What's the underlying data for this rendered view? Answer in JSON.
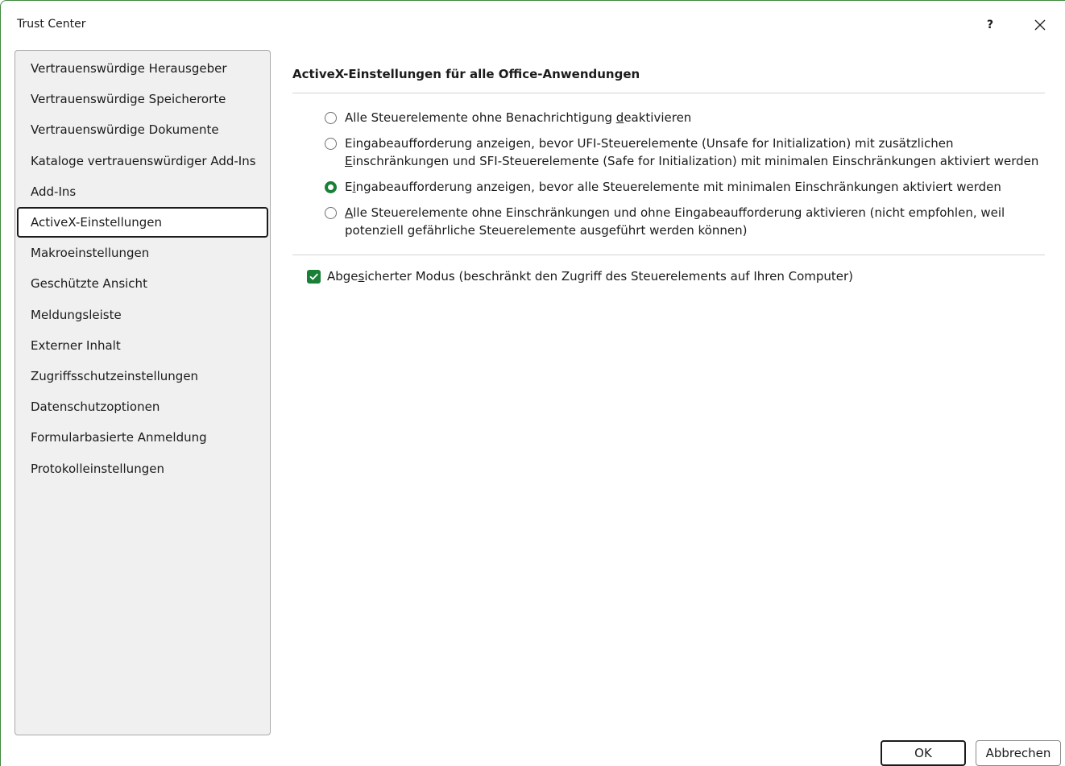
{
  "window": {
    "title": "Trust Center",
    "help_label": "?"
  },
  "sidebar": {
    "items": [
      {
        "label": "Vertrauenswürdige Herausgeber",
        "selected": false
      },
      {
        "label": "Vertrauenswürdige Speicherorte",
        "selected": false
      },
      {
        "label": "Vertrauenswürdige Dokumente",
        "selected": false
      },
      {
        "label": "Kataloge vertrauenswürdiger Add-Ins",
        "selected": false
      },
      {
        "label": "Add-Ins",
        "selected": false
      },
      {
        "label": "ActiveX-Einstellungen",
        "selected": true
      },
      {
        "label": "Makroeinstellungen",
        "selected": false
      },
      {
        "label": "Geschützte Ansicht",
        "selected": false
      },
      {
        "label": "Meldungsleiste",
        "selected": false
      },
      {
        "label": "Externer Inhalt",
        "selected": false
      },
      {
        "label": "Zugriffsschutzeinstellungen",
        "selected": false
      },
      {
        "label": "Datenschutzoptionen",
        "selected": false
      },
      {
        "label": "Formularbasierte Anmeldung",
        "selected": false
      },
      {
        "label": "Protokolleinstellungen",
        "selected": false
      }
    ]
  },
  "main": {
    "section_title": "ActiveX-Einstellungen für alle Office-Anwendungen",
    "options": [
      {
        "pre": "Alle Steuerelemente ohne Benachrichtigung ",
        "ul": "d",
        "post": "eaktivieren",
        "checked": false
      },
      {
        "pre": "Eingabeaufforderung anzeigen, bevor UFI-Steuerelemente (Unsafe for Initialization) mit zusätzlichen ",
        "ul": "E",
        "post": "inschränkungen und SFI-Steuerelemente (Safe for Initialization) mit minimalen Einschränkungen aktiviert werden",
        "checked": false
      },
      {
        "pre": "E",
        "ul": "i",
        "post": "ngabeaufforderung anzeigen, bevor alle Steuerelemente mit minimalen Einschränkungen aktiviert werden",
        "checked": true
      },
      {
        "pre": "",
        "ul": "A",
        "post": "lle Steuerelemente ohne Einschränkungen und ohne Eingabeaufforderung aktivieren (nicht empfohlen, weil potenziell gefährliche Steuerelemente ausgeführt werden können)",
        "checked": false
      }
    ],
    "safe_mode": {
      "pre": "Abge",
      "ul": "s",
      "post": "icherter Modus (beschränkt den Zugriff des Steuerelements auf Ihren Computer)",
      "checked": true
    }
  },
  "footer": {
    "ok_label": "OK",
    "cancel_label": "Abbrechen"
  },
  "colors": {
    "accent": "#1a7f37",
    "window_border": "#3c8a3c",
    "sidebar_bg": "#f0f0f0"
  }
}
